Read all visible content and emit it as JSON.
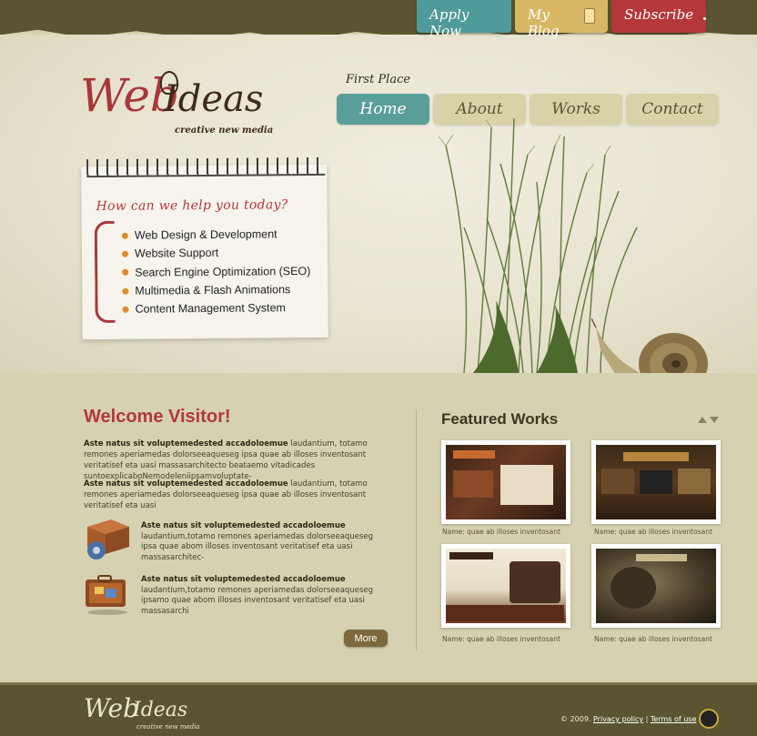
{
  "top_tabs": {
    "apply": "Apply Now",
    "blog": "My Blog",
    "subscribe": "Subscribe"
  },
  "logo": {
    "part1": "Web",
    "part2": "Ideas",
    "tagline": "creative new media"
  },
  "nav": {
    "first_place": "First Place",
    "items": [
      "Home",
      "About",
      "Works",
      "Contact"
    ],
    "active": "Home"
  },
  "help_note": {
    "title": "How can we help you today?",
    "services": [
      "Web Design & Development",
      "Website Support",
      "Search Engine Optimization (SEO)",
      "Multimedia & Flash Animations",
      "Content Management System"
    ]
  },
  "welcome": {
    "title": "Welcome Visitor!",
    "para1_bold": "Aste natus sit voluptemedested accadoloemue",
    "para1_text": " laudantium, totamo remones aperiamedas dolorseeaqueseg ipsa quae ab illoses inventosant veritatisef eta uasi massasarchitecto beataemo vitadicades suntoexplicaboNemodeleniipsamvoluptate-",
    "para2_bold": "Aste natus sit voluptemedested accadoloemue",
    "para2_text": " laudantium, totamo remones aperiamedas dolorseeaqueseg ipsa quae ab illoses inventosant veritatisef eta uasi",
    "feature1_title": "Aste natus sit voluptemedested accadoloemue",
    "feature1_text": "laudantium,totamo remones aperiamedas dolorseeaqueseg ipsa quae abom illoses inventosant veritatisef eta uasi massasarchitec-",
    "feature2_title": "Aste natus sit voluptemedested accadoloemue",
    "feature2_text": "laudantium,totamo remones aperiamedas dolorseeaqueseg ipsamo quae abom illoses inventosant veritatisef eta uasi massasarchi",
    "more": "More"
  },
  "featured": {
    "title": "Featured Works",
    "captions": [
      "Name: quae ab illoses inventosant",
      "Name: quae ab illoses inventosant",
      "Name: quae ab illoses inventosant",
      "Name: quae ab illoses inventosant"
    ]
  },
  "footer": {
    "logo_part1": "Web",
    "logo_part2": "Ideas",
    "logo_tagline": "creative new media",
    "copyright": "© 2009.",
    "privacy": "Privacy policy",
    "separator": "|",
    "terms": "Terms of use"
  },
  "colors": {
    "brand_red": "#b4383a",
    "teal": "#5a9e99",
    "olive_dark": "#5a5530",
    "sand": "#d6d1b0"
  }
}
